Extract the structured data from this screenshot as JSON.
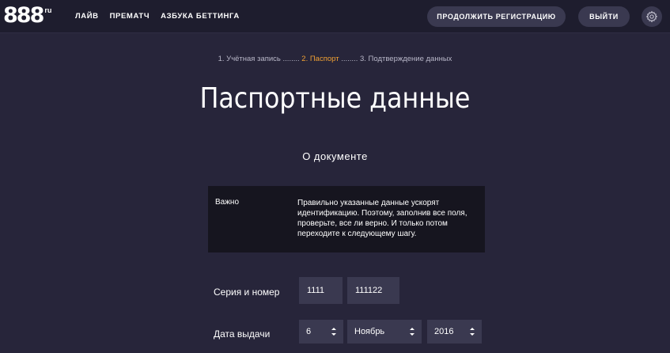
{
  "header": {
    "logo": {
      "digits": "888",
      "suffix": "ru"
    },
    "nav": [
      "ЛАЙВ",
      "ПРЕМАТЧ",
      "АЗБУКА БЕТТИНГА"
    ],
    "continue_label": "ПРОДОЛЖИТЬ РЕГИСТРАЦИЮ",
    "logout_label": "ВЫЙТИ",
    "settings_icon": "gear-icon"
  },
  "steps": {
    "step1": "1. Учётная запись",
    "sep1": " ........ ",
    "step2": "2. Паспорт",
    "sep2": " ........ ",
    "step3": "3. Подтверждение данных"
  },
  "page_title": "Паспортные данные",
  "section_title": "О документе",
  "info": {
    "label": "Важно",
    "text": "Правильно указанные данные ускорят идентификацию. Поэтому, заполнив все поля, проверьте, все ли верно. И только потом переходите к следующему шагу."
  },
  "form": {
    "series_label": "Серия и номер",
    "series_value": "1111",
    "number_value": "111122",
    "date_label": "Дата выдачи",
    "day_value": "6",
    "month_value": "Ноябрь",
    "year_value": "2016"
  },
  "colors": {
    "background": "#27253a",
    "header": "#1e1d2e",
    "accent": "#f0a033",
    "field": "#3a3950",
    "info_box": "#16151f"
  }
}
